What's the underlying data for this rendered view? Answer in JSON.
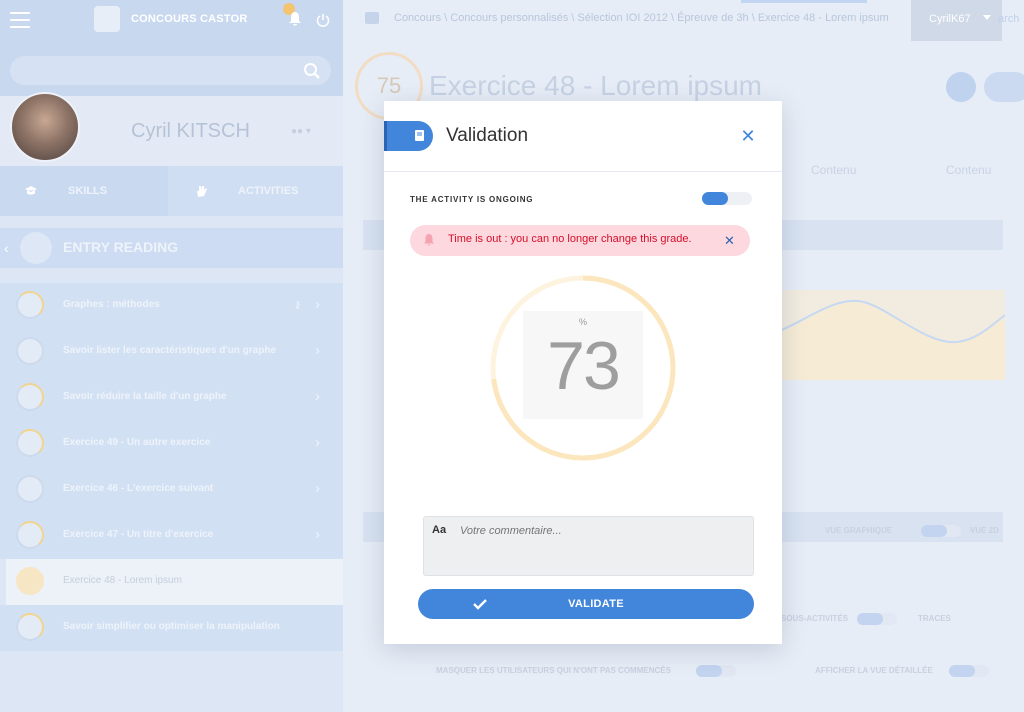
{
  "app": {
    "title": "CONCOURS CASTOR"
  },
  "search": {
    "placeholder": ""
  },
  "profile": {
    "name": "Cyril KITSCH"
  },
  "tabs": [
    {
      "label": "SKILLS"
    },
    {
      "label": "ACTIVITIES"
    }
  ],
  "section": {
    "title": "ENTRY READING"
  },
  "activities": [
    {
      "label": "Graphes : méthodes"
    },
    {
      "label": "Savoir lister les caractéristiques d'un graphe"
    },
    {
      "label": "Savoir réduire la taille d'un graphe"
    },
    {
      "label": "Exercice 49 - Un autre exercice"
    },
    {
      "label": "Exercice 46 - L'exercice suivant"
    },
    {
      "label": "Exercice 47 - Un titre d'exercice"
    },
    {
      "label": "Exercice 48 - Lorem ipsum"
    },
    {
      "label": "Savoir simplifier ou optimiser la manipulation"
    }
  ],
  "breadcrumb": {
    "text": "Concours \\ Concours personnalisés \\ Sélection IOI 2012 \\ Épreuve de 3h \\ Exercice 48 - Lorem ipsum"
  },
  "user_menu": {
    "label": "CyrilK67"
  },
  "search_link": {
    "label": "arch"
  },
  "exercise": {
    "score": "75",
    "title": "Exercice 48 - Lorem ipsum"
  },
  "content_tabs": [
    {
      "label": "Contenu"
    },
    {
      "label": "Contenu"
    }
  ],
  "bg_labels": {
    "vue2d_off": "VUE GRAPHIQUE",
    "vue2d": "VUE 2D",
    "sub_activities": "SOUS-ACTIVITÉS",
    "traces": "TRACES",
    "hide_users": "MASQUER LES UTILISATEURS QUI N'ONT PAS COMMENCÉS",
    "detailed_view": "AFFICHER LA VUE DÉTAILLÉE"
  },
  "modal": {
    "title": "Validation",
    "ongoing_label": "THE ACTIVITY IS ONGOING",
    "ongoing": true,
    "alert": "Time is out : you can no longer change this grade.",
    "grade": {
      "value": "73",
      "unit": "%",
      "fraction": 0.73
    },
    "comment": {
      "label": "Aa",
      "placeholder": "Votre commentaire..."
    },
    "validate_label": "VALIDATE"
  },
  "colors": {
    "accent": "#4286dc",
    "alert_bg": "#fdd8de",
    "alert_text": "#d5102a",
    "gauge_track": "#fdf3df"
  }
}
